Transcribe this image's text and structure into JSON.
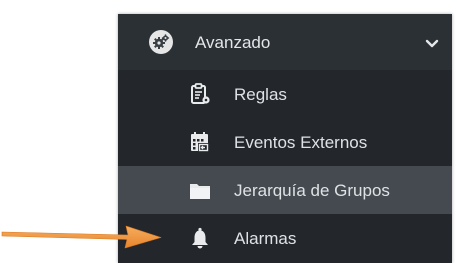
{
  "menu": {
    "header": {
      "label": "Avanzado",
      "icon": "gears-icon",
      "expand_icon": "chevron-down-icon"
    },
    "items": [
      {
        "label": "Reglas",
        "icon": "clipboard-gear-icon",
        "active": false
      },
      {
        "label": "Eventos Externos",
        "icon": "calendar-import-icon",
        "active": false
      },
      {
        "label": "Jerarquía de Grupos",
        "icon": "folder-icon",
        "active": true
      },
      {
        "label": "Alarmas",
        "icon": "bell-icon",
        "active": false
      }
    ]
  },
  "annotation": {
    "icon": "orange-arrow-pointer",
    "color": "#f0963c"
  },
  "colors": {
    "menu_bg": "#23272b",
    "header_bg": "#2b3035",
    "active_bg": "#444a50",
    "text": "#dfe2e5"
  }
}
